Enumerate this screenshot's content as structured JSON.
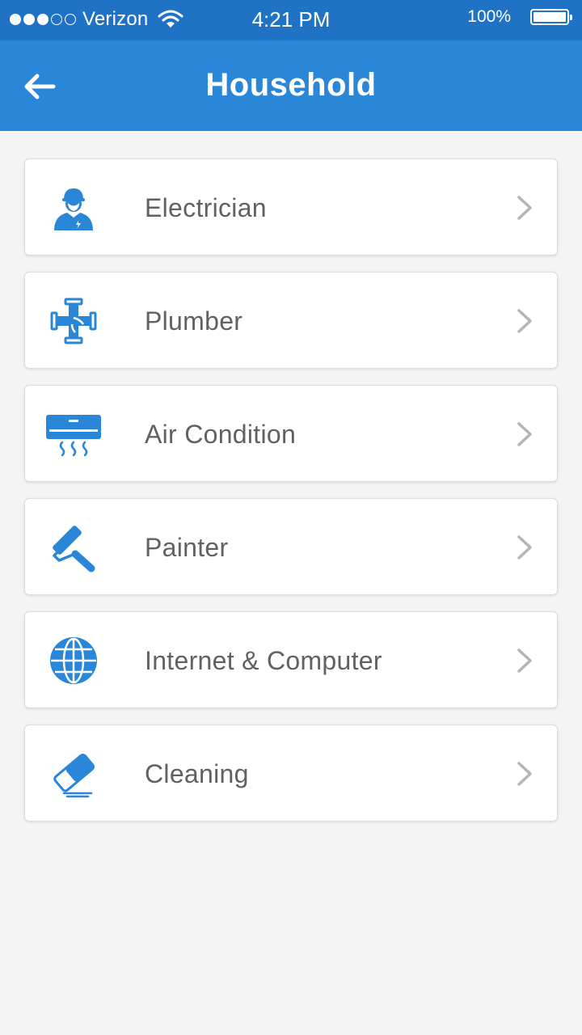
{
  "status_bar": {
    "carrier": "Verizon",
    "time": "4:21 PM",
    "battery": "100%",
    "signal_bars": 3,
    "signal_max": 5
  },
  "app_bar": {
    "title": "Household",
    "back_icon": "arrow-left-icon"
  },
  "colors": {
    "status_bar": "#1f72c4",
    "app_bar": "#2a86d6",
    "icon_blue": "#2a86d6",
    "label_text": "#616161",
    "chevron": "#b5b5b5",
    "background": "#f4f4f4"
  },
  "services": [
    {
      "label": "Electrician",
      "icon": "electrician-icon"
    },
    {
      "label": "Plumber",
      "icon": "pipe-icon"
    },
    {
      "label": "Air Condition",
      "icon": "air-conditioner-icon"
    },
    {
      "label": "Painter",
      "icon": "paint-roller-icon"
    },
    {
      "label": "Internet & Computer",
      "icon": "globe-icon"
    },
    {
      "label": "Cleaning",
      "icon": "eraser-icon"
    }
  ]
}
